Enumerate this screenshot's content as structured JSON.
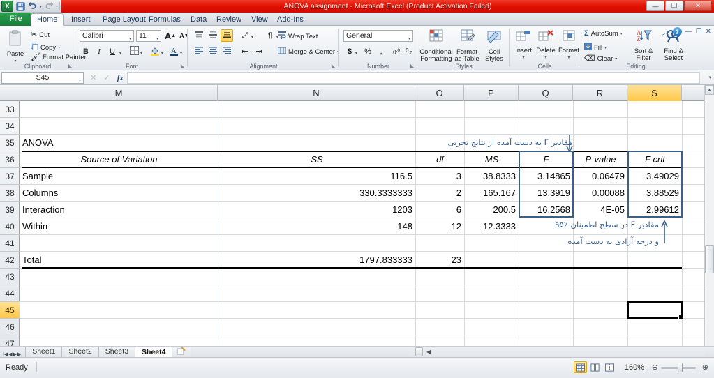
{
  "window": {
    "title": "ANOVA assignment  -  Microsoft Excel (Product Activation Failed)",
    "minimize": "—",
    "maximize": "❐",
    "close": "✕"
  },
  "qat": {
    "app_icon": "X",
    "save_icon": "save-icon",
    "undo_icon": "↺",
    "redo_icon": "↻",
    "customize_icon": "▾"
  },
  "help": {
    "minimize_ribbon": "︿",
    "question": "?",
    "restore_down": "❐",
    "win_min": "—",
    "win_close": "✕"
  },
  "tabs": [
    {
      "label": "File",
      "active": false,
      "file": true
    },
    {
      "label": "Home",
      "active": true
    },
    {
      "label": "Insert",
      "active": false
    },
    {
      "label": "Page Layout",
      "active": false
    },
    {
      "label": "Formulas",
      "active": false
    },
    {
      "label": "Data",
      "active": false
    },
    {
      "label": "Review",
      "active": false
    },
    {
      "label": "View",
      "active": false
    },
    {
      "label": "Add-Ins",
      "active": false
    }
  ],
  "ribbon": {
    "clipboard": {
      "label": "Clipboard",
      "paste": "Paste",
      "cut": "Cut",
      "copy": "Copy",
      "format_painter": "Format Painter"
    },
    "font": {
      "label": "Font",
      "family": "Calibri",
      "size": "11",
      "grow": "A",
      "shrink": "A",
      "bold": "B",
      "italic": "I",
      "underline": "U",
      "borders": "borders-icon",
      "fill_color": "fill-color-icon",
      "font_color": "A"
    },
    "alignment": {
      "label": "Alignment",
      "align_top": "align-top-icon",
      "align_middle": "align-middle-icon",
      "align_bottom": "align-bottom-icon",
      "orientation": "orientation-icon",
      "text_direction": "text-direction-icon",
      "align_left": "align-left-icon",
      "align_center": "align-center-icon",
      "align_right": "align-right-icon",
      "decrease_indent": "decrease-indent-icon",
      "increase_indent": "increase-indent-icon",
      "wrap_text": "Wrap Text",
      "merge_center": "Merge & Center"
    },
    "number": {
      "label": "Number",
      "format": "General",
      "accounting": "$",
      "percent": "%",
      "comma": ",",
      "increase_decimal": "increase-decimal-icon",
      "decrease_decimal": "decrease-decimal-icon"
    },
    "styles": {
      "label": "Styles",
      "conditional_formatting": "Conditional\nFormatting",
      "conditional_formatting_l1": "Conditional",
      "conditional_formatting_l2": "Formatting",
      "format_as_table_l1": "Format",
      "format_as_table_l2": "as Table",
      "cell_styles_l1": "Cell",
      "cell_styles_l2": "Styles"
    },
    "cells": {
      "label": "Cells",
      "insert": "Insert",
      "delete": "Delete",
      "format": "Format"
    },
    "editing": {
      "label": "Editing",
      "autosum": "AutoSum",
      "fill": "Fill",
      "clear": "Clear",
      "sort_filter_l1": "Sort &",
      "sort_filter_l2": "Filter",
      "find_select_l1": "Find &",
      "find_select_l2": "Select"
    }
  },
  "formula_bar": {
    "name_box": "S45",
    "cancel_icon": "✕",
    "enter_icon": "✓",
    "fx_icon": "fx",
    "formula_value": ""
  },
  "grid": {
    "columns": [
      "M",
      "N",
      "O",
      "P",
      "Q",
      "R",
      "S"
    ],
    "selected_column": "S",
    "rows": [
      "33",
      "34",
      "35",
      "36",
      "37",
      "38",
      "39",
      "40",
      "41",
      "42",
      "43",
      "44",
      "45",
      "46",
      "47"
    ],
    "selected_row": "45",
    "active_cell": "S45",
    "cells": {
      "anova_title": "ANOVA",
      "headers": {
        "source": "Source of Variation",
        "ss": "SS",
        "df": "df",
        "ms": "MS",
        "f": "F",
        "pvalue": "P-value",
        "fcrit": "F crit"
      },
      "rows": [
        {
          "source": "Sample",
          "ss": "116.5",
          "df": "3",
          "ms": "38.8333",
          "f": "3.14865",
          "pvalue": "0.06479",
          "fcrit": "3.49029"
        },
        {
          "source": "Columns",
          "ss": "330.3333333",
          "df": "2",
          "ms": "165.167",
          "f": "13.3919",
          "pvalue": "0.00088",
          "fcrit": "3.88529"
        },
        {
          "source": "Interaction",
          "ss": "1203",
          "df": "6",
          "ms": "200.5",
          "f": "16.2568",
          "pvalue": "4E-05",
          "fcrit": "2.99612"
        },
        {
          "source": "Within",
          "ss": "148",
          "df": "12",
          "ms": "12.3333",
          "f": "",
          "pvalue": "",
          "fcrit": ""
        }
      ],
      "total": {
        "source": "Total",
        "ss": "1797.833333",
        "df": "23",
        "ms": "",
        "f": "",
        "pvalue": "",
        "fcrit": ""
      }
    },
    "annotations": {
      "top": "مقادیر F به دست آمده از نتایج تجربی",
      "bottom_line1": "مقادیر F در سطح اطمینان ٪۹۵",
      "bottom_line2": "و درجه آزادی به دست آمده"
    }
  },
  "sheet_tabs": {
    "first_icon": "|◀",
    "prev_icon": "◀",
    "next_icon": "▶",
    "last_icon": "▶|",
    "tabs": [
      {
        "label": "Sheet1",
        "active": false
      },
      {
        "label": "Sheet2",
        "active": false
      },
      {
        "label": "Sheet3",
        "active": false
      },
      {
        "label": "Sheet4",
        "active": true
      }
    ],
    "new_sheet_icon": "insert-worksheet-icon"
  },
  "status_bar": {
    "mode": "Ready",
    "view_normal": "normal-view-icon",
    "view_page_layout": "page-layout-view-icon",
    "view_page_break": "page-break-view-icon",
    "zoom": "160%",
    "zoom_out": "−",
    "zoom_in": "+"
  },
  "colors": {
    "title_red": "#e01000",
    "accent_blue": "#3a5f8a",
    "selection_yellow": "#ffc847",
    "file_green": "#15803a"
  }
}
